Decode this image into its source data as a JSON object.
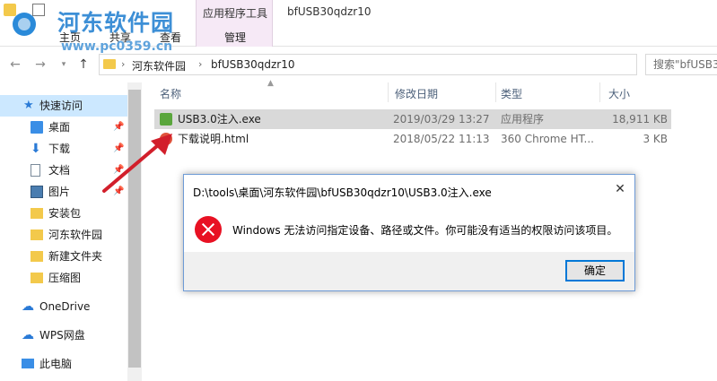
{
  "ribbon": {
    "tabs": [
      "主页",
      "共享",
      "查看"
    ],
    "context_group_title": "应用程序工具",
    "context_tab": "管理",
    "window_title": "bfUSB30qdzr10"
  },
  "watermark": {
    "brand": "河东软件园",
    "url": "www.pc0359.cn"
  },
  "address": {
    "crumbs": [
      "河东软件园",
      "bfUSB30qdzr10"
    ],
    "search_placeholder": "搜索\"bfUSB30"
  },
  "nav_pane": {
    "items": [
      {
        "label": "快速访问",
        "icon": "star-icon",
        "pinned": false
      },
      {
        "label": "桌面",
        "icon": "desktop-icon",
        "pinned": true
      },
      {
        "label": "下载",
        "icon": "download-icon",
        "pinned": true
      },
      {
        "label": "文档",
        "icon": "document-icon",
        "pinned": true
      },
      {
        "label": "图片",
        "icon": "picture-icon",
        "pinned": true
      },
      {
        "label": "安装包",
        "icon": "folder-icon",
        "pinned": false
      },
      {
        "label": "河东软件园",
        "icon": "folder-icon",
        "pinned": false
      },
      {
        "label": "新建文件夹",
        "icon": "folder-icon",
        "pinned": false
      },
      {
        "label": "压缩图",
        "icon": "folder-icon",
        "pinned": false
      },
      {
        "label": "OneDrive",
        "icon": "cloud-icon",
        "pinned": false
      },
      {
        "label": "WPS网盘",
        "icon": "cloud-icon",
        "pinned": false
      },
      {
        "label": "此电脑",
        "icon": "computer-icon",
        "pinned": false
      }
    ]
  },
  "file_list": {
    "columns": [
      "名称",
      "修改日期",
      "类型",
      "大小"
    ],
    "rows": [
      {
        "name": "USB3.0注入.exe",
        "modified": "2019/03/29 13:27",
        "type": "应用程序",
        "size": "18,911 KB",
        "icon": "exe-icon"
      },
      {
        "name": "下载说明.html",
        "modified": "2018/05/22 11:13",
        "type": "360 Chrome HT...",
        "size": "3 KB",
        "icon": "html-icon"
      }
    ]
  },
  "dialog": {
    "title": "D:\\tools\\桌面\\河东软件园\\bfUSB30qdzr10\\USB3.0注入.exe",
    "message": "Windows 无法访问指定设备、路径或文件。你可能没有适当的权限访问该项目。",
    "ok_label": "确定",
    "close_glyph": "✕"
  },
  "colors": {
    "selection": "#cce8ff",
    "row_selected": "#d9d9d9",
    "error_red": "#e81123",
    "accent_blue": "#0078d7",
    "arrow_red": "#d21f2b"
  }
}
